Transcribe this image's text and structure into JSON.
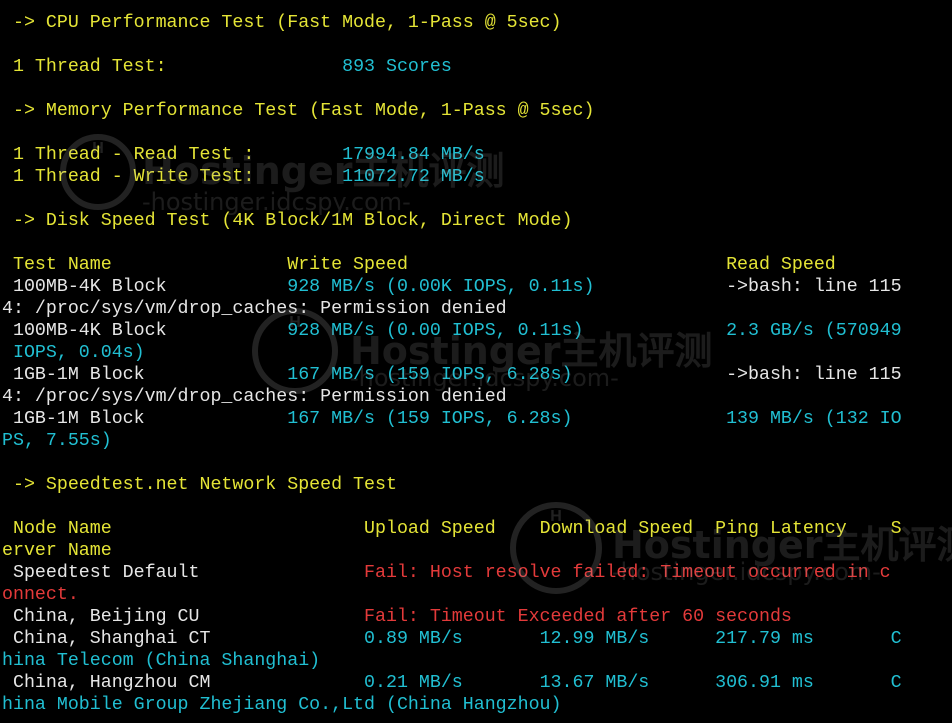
{
  "terminal": {
    "lines": [
      [
        {
          "text": " -> CPU Performance Test (Fast Mode, 1-Pass @ 5sec)",
          "color": "yellow"
        }
      ],
      [],
      [
        {
          "text": " 1 Thread Test:                ",
          "color": "yellow"
        },
        {
          "text": "893 Scores",
          "color": "cyan"
        }
      ],
      [],
      [
        {
          "text": " -> Memory Performance Test (Fast Mode, 1-Pass @ 5sec)",
          "color": "yellow"
        }
      ],
      [],
      [
        {
          "text": " 1 Thread - Read Test :        ",
          "color": "yellow"
        },
        {
          "text": "17994.84 MB/s",
          "color": "cyan"
        }
      ],
      [
        {
          "text": " 1 Thread - Write Test:        ",
          "color": "yellow"
        },
        {
          "text": "11072.72 MB/s",
          "color": "cyan"
        }
      ],
      [],
      [
        {
          "text": " -> Disk Speed Test (4K Block/1M Block, Direct Mode)",
          "color": "yellow"
        }
      ],
      [],
      [
        {
          "text": " Test Name                ",
          "color": "yellow"
        },
        {
          "text": "Write Speed                             ",
          "color": "yellow"
        },
        {
          "text": "Read Speed",
          "color": "yellow"
        }
      ],
      [
        {
          "text": " 100MB-4K Block           ",
          "color": "white"
        },
        {
          "text": "928 MB/s (0.00K IOPS, 0.11s)            ",
          "color": "cyan"
        },
        {
          "text": "->bash: line 115",
          "color": "white"
        }
      ],
      [
        {
          "text": "4: /proc/sys/vm/drop_caches: Permission denied",
          "color": "white"
        }
      ],
      [
        {
          "text": " 100MB-4K Block           ",
          "color": "white"
        },
        {
          "text": "928 MB/s (0.00 IOPS, 0.11s)             ",
          "color": "cyan"
        },
        {
          "text": "2.3 GB/s (570949",
          "color": "cyan"
        }
      ],
      [
        {
          "text": " IOPS, 0.04s)",
          "color": "cyan"
        }
      ],
      [
        {
          "text": " 1GB-1M Block             ",
          "color": "white"
        },
        {
          "text": "167 MB/s (159 IOPS, 6.28s)              ",
          "color": "cyan"
        },
        {
          "text": "->bash: line 115",
          "color": "white"
        }
      ],
      [
        {
          "text": "4: /proc/sys/vm/drop_caches: Permission denied",
          "color": "white"
        }
      ],
      [
        {
          "text": " 1GB-1M Block             ",
          "color": "white"
        },
        {
          "text": "167 MB/s (159 IOPS, 6.28s)              ",
          "color": "cyan"
        },
        {
          "text": "139 MB/s (132 IO",
          "color": "cyan"
        }
      ],
      [
        {
          "text": "PS, 7.55s)",
          "color": "cyan"
        }
      ],
      [],
      [
        {
          "text": " -> Speedtest.net Network Speed Test",
          "color": "yellow"
        }
      ],
      [],
      [
        {
          "text": " Node Name                       ",
          "color": "yellow"
        },
        {
          "text": "Upload Speed    ",
          "color": "yellow"
        },
        {
          "text": "Download Speed  ",
          "color": "yellow"
        },
        {
          "text": "Ping Latency    ",
          "color": "yellow"
        },
        {
          "text": "S",
          "color": "yellow"
        }
      ],
      [
        {
          "text": "erver Name",
          "color": "yellow"
        }
      ],
      [
        {
          "text": " Speedtest Default               ",
          "color": "white"
        },
        {
          "text": "Fail: Host resolve failed: Timeout occurred in c",
          "color": "red"
        }
      ],
      [
        {
          "text": "onnect.",
          "color": "red"
        }
      ],
      [
        {
          "text": " China, Beijing CU               ",
          "color": "white"
        },
        {
          "text": "Fail: Timeout Exceeded after 60 seconds",
          "color": "red"
        }
      ],
      [
        {
          "text": " China, Shanghai CT              ",
          "color": "white"
        },
        {
          "text": "0.89 MB/s       ",
          "color": "cyan"
        },
        {
          "text": "12.99 MB/s      ",
          "color": "cyan"
        },
        {
          "text": "217.79 ms       ",
          "color": "cyan"
        },
        {
          "text": "C",
          "color": "cyan"
        }
      ],
      [
        {
          "text": "hina Telecom (China Shanghai)",
          "color": "cyan"
        }
      ],
      [
        {
          "text": " China, Hangzhou CM              ",
          "color": "white"
        },
        {
          "text": "0.21 MB/s       ",
          "color": "cyan"
        },
        {
          "text": "13.67 MB/s      ",
          "color": "cyan"
        },
        {
          "text": "306.91 ms       ",
          "color": "cyan"
        },
        {
          "text": "C",
          "color": "cyan"
        }
      ],
      [
        {
          "text": "hina Mobile Group Zhejiang Co.,Ltd (China Hangzhou)",
          "color": "cyan"
        }
      ]
    ]
  },
  "watermarks": [
    {
      "brand": "Hostinger主机评测",
      "url": "-hostinger.idcspy.com-"
    },
    {
      "brand": "Hostinger主机评测",
      "url": "-hostinger.idcspy.com-"
    },
    {
      "brand": "Hostinger主机评测",
      "url": "-hostinger.idcspy.com-"
    }
  ],
  "colors": {
    "background": "#000000",
    "yellow": "#e4e436",
    "cyan": "#21bfd2",
    "white": "#e6e6e6",
    "red": "#e33a3a"
  }
}
